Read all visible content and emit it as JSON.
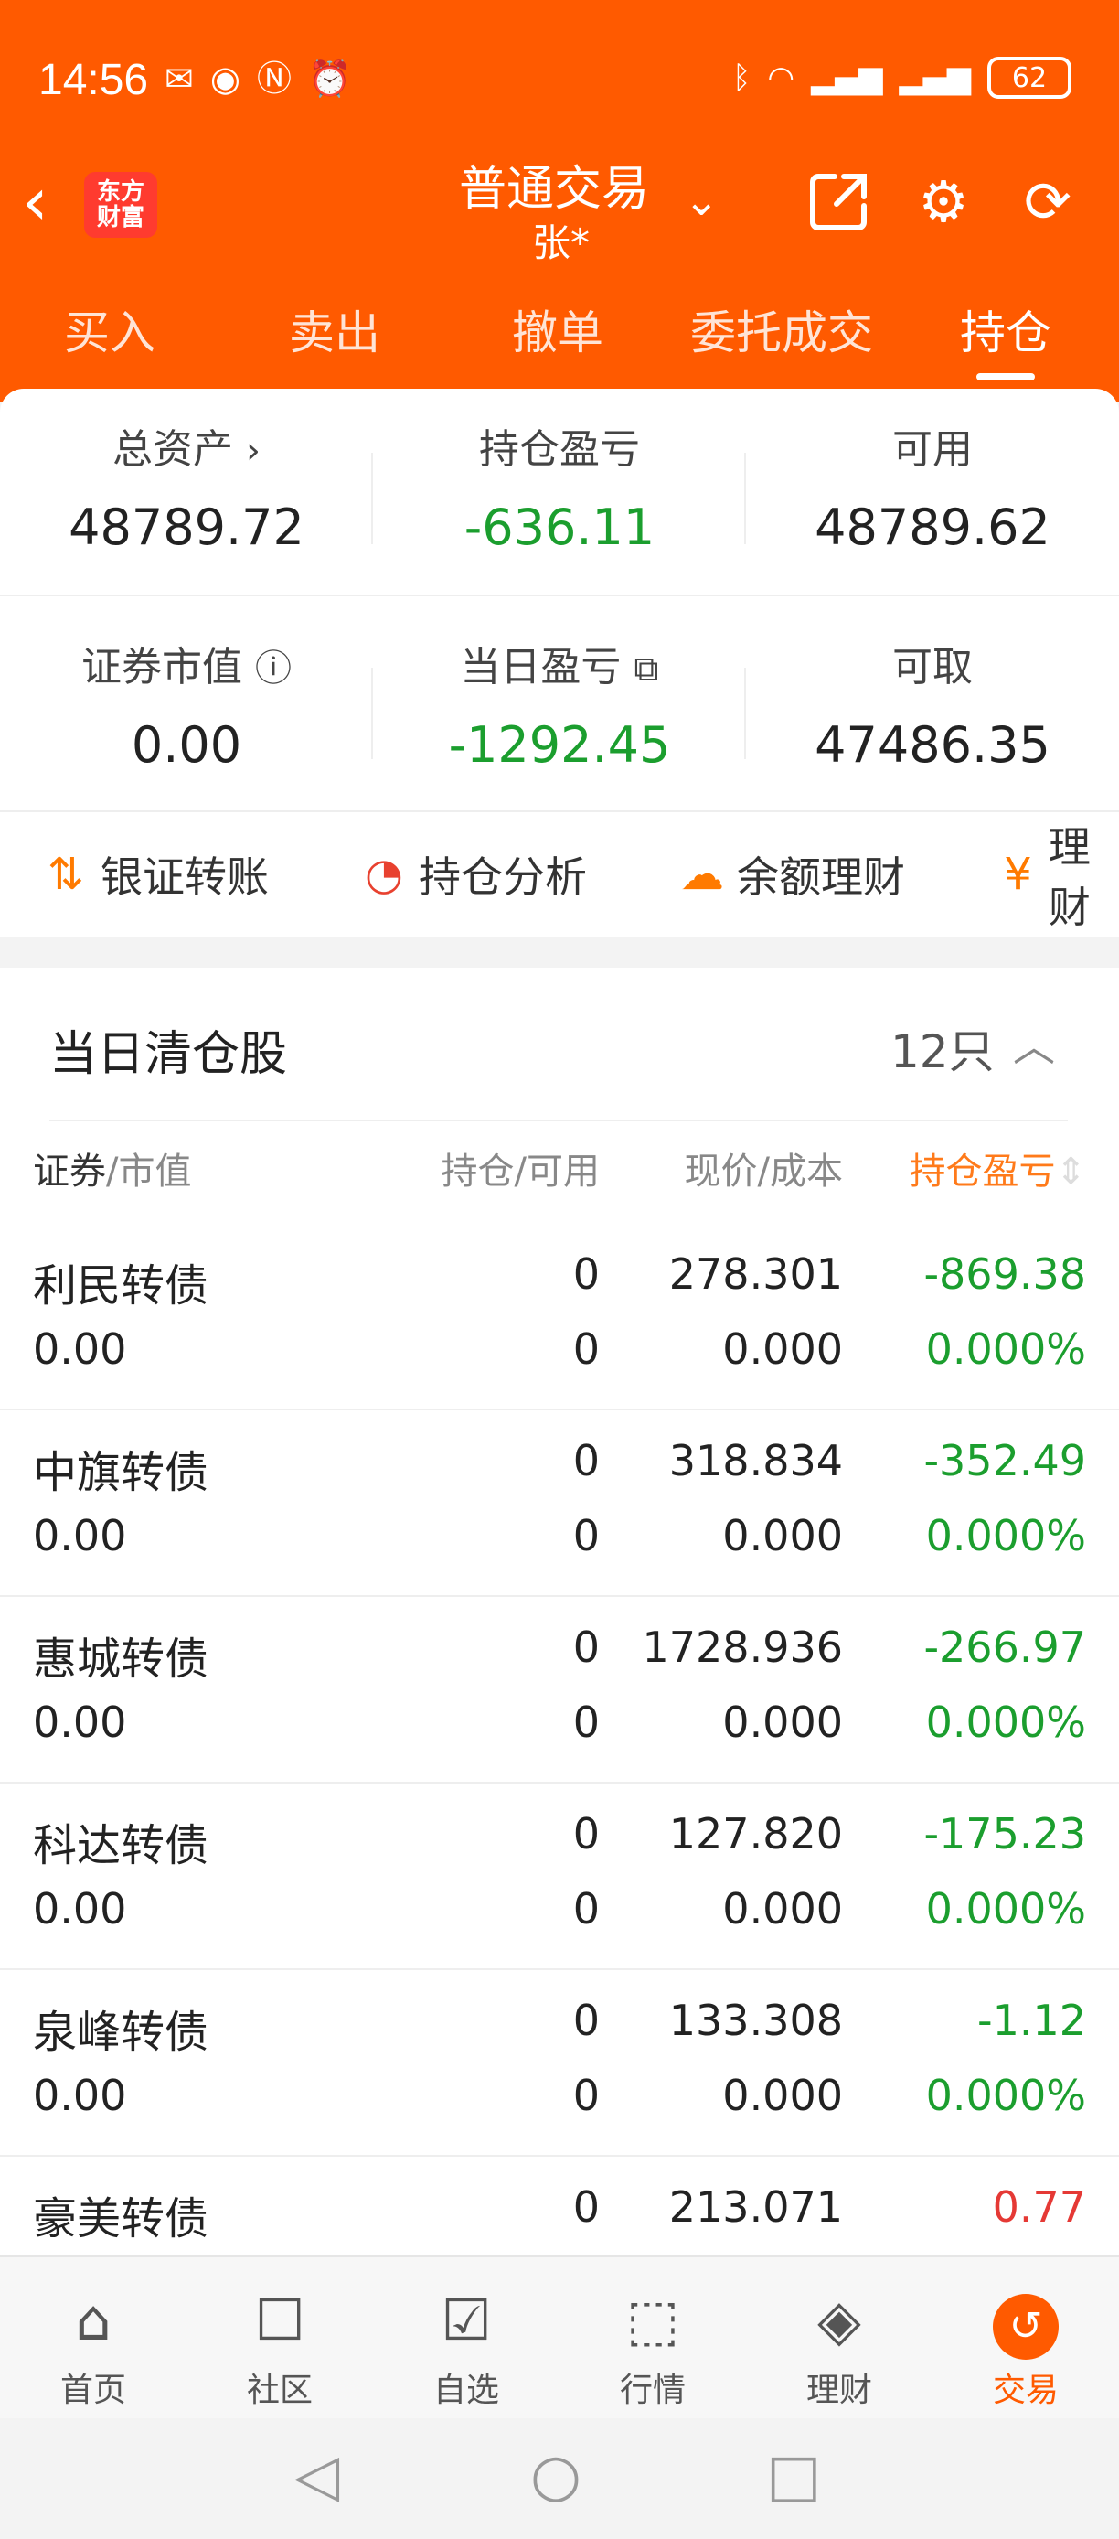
{
  "status_bar": {
    "time": "14:56",
    "left_icons": [
      "notification-icon",
      "eye-icon",
      "nfc-icon",
      "alarm-icon"
    ],
    "right_icons": [
      "bluetooth-icon",
      "wifi-icon",
      "signal-icon",
      "4g-signal-icon"
    ],
    "battery": "62"
  },
  "header": {
    "logo_line1": "东方",
    "logo_line2": "财富",
    "account_type": "普通交易",
    "account_name": "张*",
    "tabs": [
      {
        "label": "买入"
      },
      {
        "label": "卖出"
      },
      {
        "label": "撤单"
      },
      {
        "label": "委托成交"
      },
      {
        "label": "持仓"
      }
    ],
    "active_tab": "持仓"
  },
  "summary": {
    "total_assets": {
      "label": "总资产",
      "value": "48789.72"
    },
    "position_pnl": {
      "label": "持仓盈亏",
      "value": "-636.11"
    },
    "available": {
      "label": "可用",
      "value": "48789.62"
    },
    "securities_value": {
      "label": "证券市值",
      "value": "0.00"
    },
    "today_pnl": {
      "label": "当日盈亏",
      "value": "-1292.45"
    },
    "withdrawable": {
      "label": "可取",
      "value": "47486.35"
    }
  },
  "quick_actions": [
    {
      "label": "银证转账",
      "icon": "transfer-icon"
    },
    {
      "label": "持仓分析",
      "icon": "pie-chart-icon"
    },
    {
      "label": "余额理财",
      "icon": "piggy-bank-icon"
    },
    {
      "label": "理财",
      "icon": "money-bag-icon"
    }
  ],
  "section": {
    "title": "当日清仓股",
    "count": "12只"
  },
  "columns": {
    "security": "证券",
    "market_value": "/市值",
    "hold": "持仓/可用",
    "price": "现价/成本",
    "pnl": "持仓盈亏"
  },
  "rows": [
    {
      "name": "利民转债",
      "market_value": "0.00",
      "hold": "0",
      "avail": "0",
      "price": "278.301",
      "cost": "0.000",
      "pnl": "-869.38",
      "pnl_pct": "0.000%"
    },
    {
      "name": "中旗转债",
      "market_value": "0.00",
      "hold": "0",
      "avail": "0",
      "price": "318.834",
      "cost": "0.000",
      "pnl": "-352.49",
      "pnl_pct": "0.000%"
    },
    {
      "name": "惠城转债",
      "market_value": "0.00",
      "hold": "0",
      "avail": "0",
      "price": "1728.936",
      "cost": "0.000",
      "pnl": "-266.97",
      "pnl_pct": "0.000%"
    },
    {
      "name": "科达转债",
      "market_value": "0.00",
      "hold": "0",
      "avail": "0",
      "price": "127.820",
      "cost": "0.000",
      "pnl": "-175.23",
      "pnl_pct": "0.000%"
    },
    {
      "name": "泉峰转债",
      "market_value": "0.00",
      "hold": "0",
      "avail": "0",
      "price": "133.308",
      "cost": "0.000",
      "pnl": "-1.12",
      "pnl_pct": "0.000%"
    },
    {
      "name": "豪美转债",
      "hold": "0",
      "price": "213.071",
      "pnl": "0.77"
    }
  ],
  "bottom_nav": [
    {
      "label": "首页",
      "icon": "home-icon"
    },
    {
      "label": "社区",
      "icon": "chat-icon"
    },
    {
      "label": "自选",
      "icon": "watchlist-icon"
    },
    {
      "label": "行情",
      "icon": "market-chart-icon"
    },
    {
      "label": "理财",
      "icon": "diamond-icon"
    },
    {
      "label": "交易",
      "icon": "trade-icon"
    }
  ],
  "colors": {
    "brand": "#ff5a00",
    "loss_green": "#1b9e2e",
    "gain_red": "#e53935"
  }
}
